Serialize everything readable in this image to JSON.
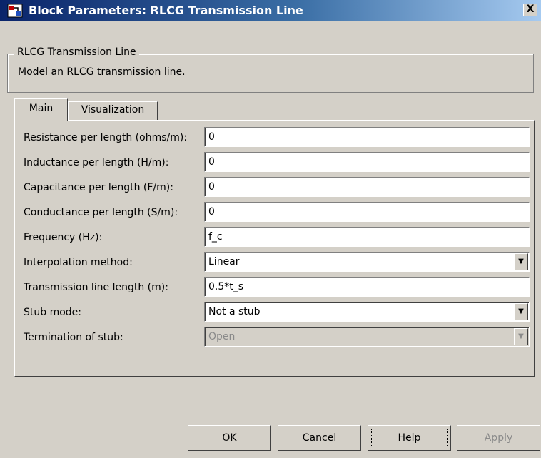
{
  "window": {
    "title": "Block Parameters: RLCG Transmission Line",
    "close_label": "X"
  },
  "description_group": {
    "legend": "RLCG Transmission Line",
    "text": "Model an RLCG transmission line."
  },
  "tabs": [
    {
      "label": "Main",
      "selected": true
    },
    {
      "label": "Visualization",
      "selected": false
    }
  ],
  "parameters": [
    {
      "label": "Resistance per length (ohms/m):",
      "value": "0",
      "type": "text"
    },
    {
      "label": "Inductance per length (H/m):",
      "value": "0",
      "type": "text"
    },
    {
      "label": "Capacitance per length (F/m):",
      "value": "0",
      "type": "text"
    },
    {
      "label": "Conductance per length (S/m):",
      "value": "0",
      "type": "text"
    },
    {
      "label": "Frequency (Hz):",
      "value": "f_c",
      "type": "text"
    },
    {
      "label": "Interpolation method:",
      "value": "Linear",
      "type": "dropdown"
    },
    {
      "label": "Transmission line length (m):",
      "value": "0.5*t_s",
      "type": "text"
    },
    {
      "label": "Stub mode:",
      "value": "Not a stub",
      "type": "dropdown"
    },
    {
      "label": "Termination of stub:",
      "value": "Open",
      "type": "dropdown",
      "disabled": true
    }
  ],
  "buttons": {
    "ok": "OK",
    "cancel": "Cancel",
    "help": "Help",
    "apply": "Apply"
  },
  "icons": {
    "title_icon": "simulink-block-icon",
    "dropdown_arrow": "▼"
  },
  "colors": {
    "title_bar_start": "#0a246a",
    "title_bar_end": "#a6caf0",
    "dialog_background": "#d4d0c8"
  }
}
